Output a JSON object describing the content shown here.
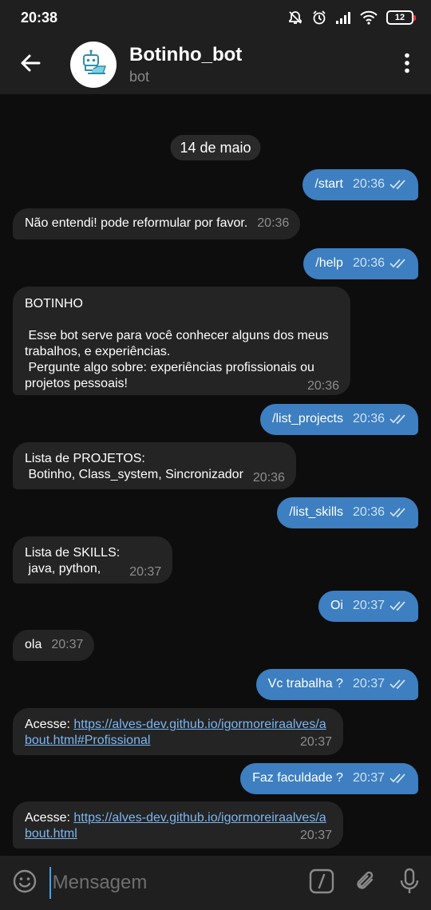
{
  "status_bar": {
    "time": "20:38",
    "battery": "12",
    "icons": [
      "alarm-off-icon",
      "alarm-icon",
      "signal-icon",
      "wifi-icon",
      "battery-icon"
    ]
  },
  "header": {
    "title": "Botinho_bot",
    "subtitle": "bot",
    "back_icon": "back-arrow-icon",
    "menu_icon": "more-vertical-icon"
  },
  "chat": {
    "date": "14 de maio",
    "messages": [
      {
        "dir": "out",
        "text": "/start",
        "time": "20:36"
      },
      {
        "dir": "in",
        "text": "Não entendi! pode reformular por favor.",
        "time": "20:36"
      },
      {
        "dir": "out",
        "text": "/help",
        "time": "20:36"
      },
      {
        "dir": "in",
        "text": "BOTINHO\n\n Esse bot serve para você conhecer alguns dos meus trabalhos, e experiências.\n Pergunte algo sobre: experiências profissionais ou projetos pessoais!",
        "time": "20:36"
      },
      {
        "dir": "out",
        "text": "/list_projects",
        "time": "20:36"
      },
      {
        "dir": "in",
        "text": "Lista de PROJETOS:\n Botinho, Class_system, Sincronizador",
        "time": "20:36"
      },
      {
        "dir": "out",
        "text": "/list_skills",
        "time": "20:36"
      },
      {
        "dir": "in",
        "text": "Lista de SKILLS:\n java, python,",
        "time": "20:37"
      },
      {
        "dir": "out",
        "text": "Oi",
        "time": "20:37"
      },
      {
        "dir": "in",
        "text": "ola",
        "time": "20:37"
      },
      {
        "dir": "out",
        "text": "Vc trabalha ?",
        "time": "20:37"
      },
      {
        "dir": "in",
        "prefix": "Acesse: ",
        "link": "https://alves-dev.github.io/igormoreiraalves/about.html#Profissional",
        "time": "20:37"
      },
      {
        "dir": "out",
        "text": "Faz faculdade ?",
        "time": "20:37"
      },
      {
        "dir": "in",
        "prefix": "Acesse: ",
        "link": "https://alves-dev.github.io/igormoreiraalves/about.html",
        "time": "20:37"
      }
    ]
  },
  "input": {
    "placeholder": "Mensagem",
    "emoji_icon": "emoji-icon",
    "command_icon": "bot-command-icon",
    "attach_icon": "paperclip-icon",
    "mic_icon": "microphone-icon"
  },
  "colors": {
    "outgoing_bubble": "#3d7fc1",
    "incoming_bubble": "#242424",
    "background": "#0d0d0d",
    "bar": "#1f1f1f",
    "link": "#7bb6f0"
  }
}
